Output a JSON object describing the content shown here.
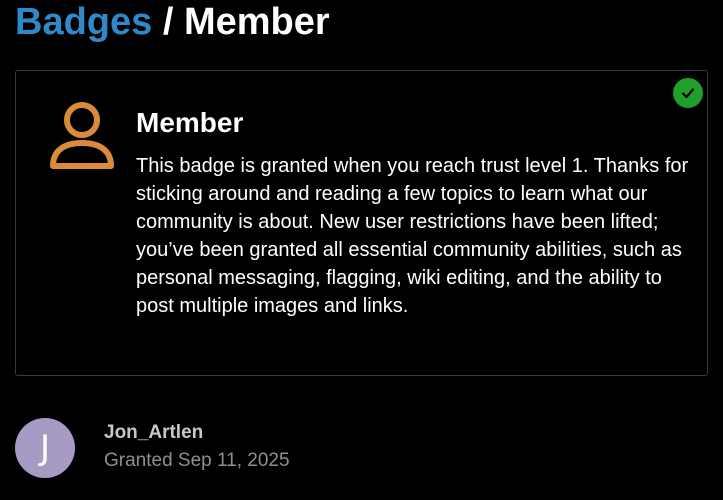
{
  "header": {
    "breadcrumb_parent": "Badges",
    "separator": " / ",
    "current": "Member"
  },
  "badge": {
    "name": "Member",
    "icon": "user-icon",
    "icon_color": "#d98b3a",
    "granted_indicator": "check-circle-icon",
    "granted_color": "#1fa02a",
    "description": "This badge is granted when you reach trust level 1. Thanks for sticking around and reading a few topics to learn what our community is about. New user restrictions have been lifted; you’ve been granted all essential community abilities, such as personal messaging, flagging, wiki editing, and the ability to post multiple images and links."
  },
  "grant": {
    "avatar_letter": "J",
    "avatar_color": "#a89bc3",
    "username": "Jon_Artlen",
    "date_text": "Granted Sep 11, 2025"
  },
  "colors": {
    "link_blue": "#2f88c8",
    "background": "#000000"
  }
}
